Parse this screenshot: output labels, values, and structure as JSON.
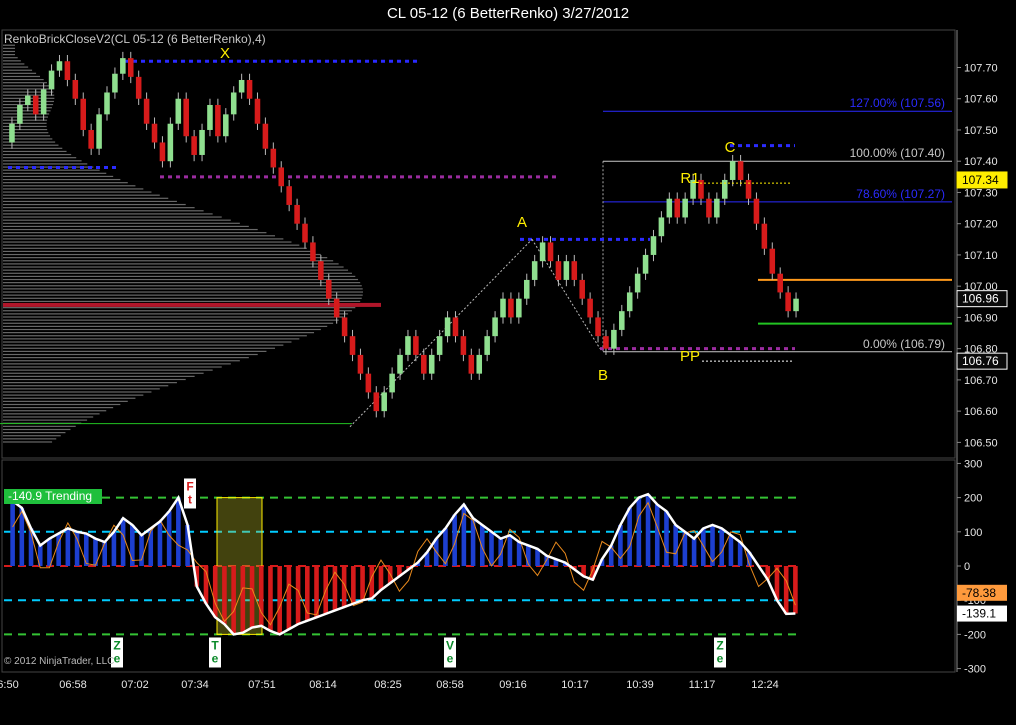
{
  "window": {
    "title": "CL 05-12 (6 BetterRenko)  3/27/2012"
  },
  "indicator_label": "RenkoBrickCloseV2(CL 05-12 (6 BetterRenko),4)",
  "copyright": "© 2012 NinjaTrader, LLC",
  "status_badge": "-140.9 Trending",
  "colors": {
    "up": "#8fdf8f",
    "down": "#d71b1b",
    "profile": "#8c8c8c",
    "grid": "#2a2a2a"
  },
  "chart_data": [
    {
      "type": "candlestick",
      "ylim": [
        106.45,
        107.82
      ],
      "yticks": [
        "107.70",
        "107.60",
        "107.50",
        "107.40",
        "107.30",
        "107.20",
        "107.10",
        "107.00",
        "106.90",
        "106.80",
        "106.70",
        "106.60",
        "106.50"
      ],
      "x_ticks": [
        "6:50",
        "06:58",
        "07:02",
        "07:34",
        "07:51",
        "08:14",
        "08:25",
        "08:58",
        "09:16",
        "10:17",
        "10:39",
        "11:17",
        "12:24"
      ],
      "price_tags": [
        {
          "label": "107.34",
          "value": 107.34,
          "color": "#ffee00",
          "text_color": "#000"
        },
        {
          "label": "106.96",
          "value": 106.96,
          "color": "#0a0a0a",
          "text_color": "#fff",
          "border": "#fff"
        },
        {
          "label": "106.76",
          "value": 106.76,
          "color": "#0a0a0a",
          "text_color": "#fff",
          "border": "#fff"
        }
      ],
      "fib_levels": [
        {
          "label": "127.00% (107.56)",
          "value": 107.56,
          "color": "#2b2bff"
        },
        {
          "label": "100.00% (107.40)",
          "value": 107.4,
          "color": "#c8c8c8"
        },
        {
          "label": "78.60% (107.27)",
          "value": 107.27,
          "color": "#2b2bff"
        },
        {
          "label": "0.00% (106.79)",
          "value": 106.79,
          "color": "#c8c8c8"
        }
      ],
      "wave_labels": [
        {
          "label": "X",
          "value": 107.73
        },
        {
          "label": "A",
          "value": 107.19
        },
        {
          "label": "B",
          "value": 106.7
        },
        {
          "label": "C",
          "value": 107.43
        },
        {
          "label": "R1",
          "value": 107.33
        },
        {
          "label": "PP",
          "value": 106.76
        }
      ],
      "closes": [
        107.52,
        107.58,
        107.61,
        107.55,
        107.63,
        107.69,
        107.72,
        107.66,
        107.6,
        107.5,
        107.44,
        107.55,
        107.62,
        107.68,
        107.73,
        107.67,
        107.6,
        107.52,
        107.46,
        107.4,
        107.52,
        107.6,
        107.48,
        107.42,
        107.5,
        107.58,
        107.48,
        107.55,
        107.62,
        107.66,
        107.6,
        107.52,
        107.44,
        107.38,
        107.32,
        107.26,
        107.2,
        107.14,
        107.08,
        107.02,
        106.96,
        106.9,
        106.84,
        106.78,
        106.72,
        106.66,
        106.6,
        106.66,
        106.72,
        106.78,
        106.84,
        106.78,
        106.72,
        106.78,
        106.84,
        106.9,
        106.84,
        106.78,
        106.72,
        106.78,
        106.84,
        106.9,
        106.96,
        106.9,
        106.96,
        107.02,
        107.08,
        107.14,
        107.08,
        107.02,
        107.08,
        107.02,
        106.96,
        106.9,
        106.84,
        106.8,
        106.86,
        106.92,
        106.98,
        107.04,
        107.1,
        107.16,
        107.22,
        107.28,
        107.22,
        107.28,
        107.34,
        107.28,
        107.22,
        107.28,
        107.34,
        107.4,
        107.34,
        107.28,
        107.2,
        107.12,
        107.04,
        106.98,
        106.92,
        106.96
      ]
    },
    {
      "type": "line",
      "ylim": [
        -310,
        310
      ],
      "yticks": [
        "300",
        "200",
        "100",
        "0",
        "-100",
        "-200",
        "-300"
      ],
      "levels": [
        {
          "value": 200,
          "color": "#34c234"
        },
        {
          "value": 100,
          "color": "#00ccff"
        },
        {
          "value": 0,
          "color": "#d71b1b"
        },
        {
          "value": -100,
          "color": "#00ccff"
        },
        {
          "value": -200,
          "color": "#34c234"
        }
      ],
      "value_tags": [
        {
          "label": "-78.38",
          "value": -78.38,
          "color": "#ff9a3c",
          "text_color": "#000"
        },
        {
          "label": "-139.1",
          "value": -139.1,
          "color": "#ffffff",
          "text_color": "#000"
        }
      ],
      "markers": [
        {
          "label": "Ft",
          "value": 230,
          "color": "#d71b1b"
        },
        {
          "label": "Ze",
          "value": -230,
          "color": "#0b8a2a"
        },
        {
          "label": "Te",
          "value": -230,
          "color": "#0b8a2a"
        },
        {
          "label": "Ve",
          "value": -230,
          "color": "#0b8a2a"
        },
        {
          "label": "Ze",
          "value": -230,
          "color": "#0b8a2a"
        }
      ],
      "series": [
        {
          "values": [
            190,
            170,
            110,
            60,
            80,
            95,
            110,
            100,
            95,
            80,
            70,
            100,
            140,
            120,
            90,
            110,
            130,
            160,
            200,
            120,
            -60,
            -110,
            -150,
            -170,
            -200,
            -195,
            -180,
            -175,
            -190,
            -200,
            -185,
            -170,
            -160,
            -150,
            -140,
            -130,
            -120,
            -110,
            -100,
            -95,
            -70,
            -50,
            -30,
            -10,
            10,
            40,
            80,
            110,
            150,
            180,
            140,
            120,
            100,
            80,
            90,
            70,
            60,
            50,
            30,
            20,
            10,
            -10,
            -30,
            -40,
            20,
            60,
            120,
            170,
            200,
            210,
            180,
            160,
            120,
            100,
            80,
            110,
            120,
            110,
            90,
            70,
            40,
            0,
            -40,
            -100,
            -140,
            -139
          ]
        }
      ]
    }
  ]
}
